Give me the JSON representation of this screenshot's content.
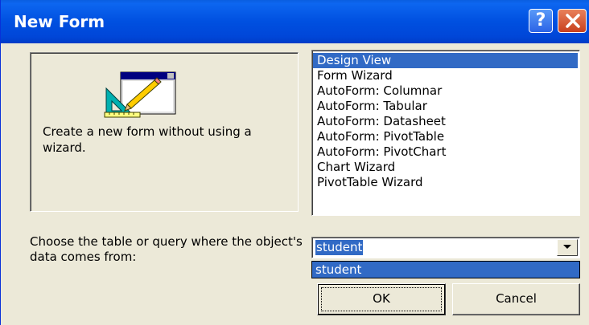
{
  "window": {
    "title": "New Form",
    "help_label": "?",
    "colors": {
      "titlebar": "#0050e0",
      "selection": "#316ac5",
      "face": "#ece9d8"
    }
  },
  "preview": {
    "icon": "form-design-icon",
    "description": "Create a new form without using a wizard."
  },
  "form_types": {
    "selected": "Design View",
    "items": [
      "Design View",
      "Form Wizard",
      "AutoForm:  Columnar",
      "AutoForm:  Tabular",
      "AutoForm:  Datasheet",
      "AutoForm:  PivotTable",
      "AutoForm:  PivotChart",
      "Chart Wizard",
      "PivotTable Wizard"
    ]
  },
  "source": {
    "label": "Choose the table or query where the object's data comes from:",
    "value": "student",
    "options": [
      "student"
    ]
  },
  "buttons": {
    "ok": "OK",
    "cancel": "Cancel"
  }
}
